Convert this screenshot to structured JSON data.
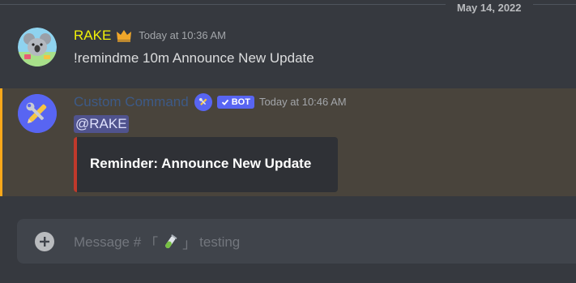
{
  "date_divider": "May 14, 2022",
  "messages": [
    {
      "author": "RAKE",
      "author_color": "#f1f108",
      "badge_icon": "crown-icon",
      "timestamp": "Today at 10:36 AM",
      "content": "!remindme 10m Announce New Update"
    },
    {
      "author": "Custom Command",
      "author_color": "#3d5a87",
      "badge_icon": "tools-icon",
      "bot_tag": "BOT",
      "timestamp": "Today at 10:46 AM",
      "mention": "@RAKE",
      "embed": {
        "title": "Reminder: Announce New Update",
        "accent_color": "#c0392b"
      },
      "highlight_color": "#faa81a"
    }
  ],
  "composer": {
    "placeholder_prefix": "Message #",
    "channel_open": "「",
    "channel_close": "」",
    "channel_name": "testing"
  }
}
